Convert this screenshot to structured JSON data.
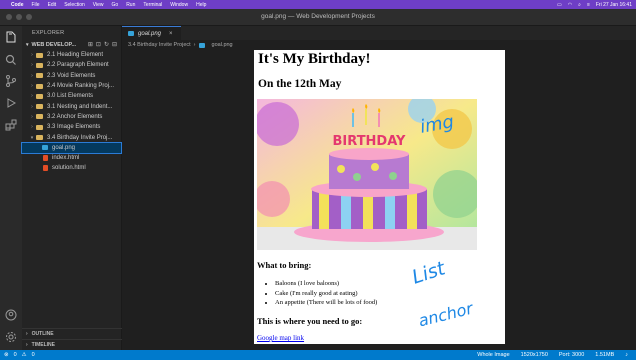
{
  "menubar": {
    "apple": "",
    "items": [
      "Code",
      "File",
      "Edit",
      "Selection",
      "View",
      "Go",
      "Run",
      "Terminal",
      "Window",
      "Help"
    ],
    "clock": "Fri 27 Jan 16:41"
  },
  "window": {
    "title": "goal.png — Web Development Projects"
  },
  "sidebar": {
    "header": "EXPLORER",
    "project": "WEB DEVELOP...",
    "items": [
      {
        "label": "2.1 Heading Element"
      },
      {
        "label": "2.2 Paragraph Element"
      },
      {
        "label": "2.3 Void Elements"
      },
      {
        "label": "2.4 Movie Ranking Proj..."
      },
      {
        "label": "3.0 List Elements"
      },
      {
        "label": "3.1 Nesting and Indent..."
      },
      {
        "label": "3.2 Anchor Elements"
      },
      {
        "label": "3.3 Image Elements"
      },
      {
        "label": "3.4 Birthday Invite Proj..."
      }
    ],
    "files": [
      {
        "label": "goal.png"
      },
      {
        "label": "index.html"
      },
      {
        "label": "solution.html"
      }
    ],
    "outline": "OUTLINE",
    "timeline": "TIMELINE"
  },
  "editor": {
    "tab": "goal.png",
    "breadcrumb": [
      "3.4 Birthday Invite Project",
      "goal.png"
    ]
  },
  "preview": {
    "h1": "It's My Birthday!",
    "h2": "On the 12th May",
    "bring_heading": "What to bring:",
    "bring_items": [
      "Baloons (I love baloons)",
      "Cake (I'm really good at eating)",
      "An appetite (There will be lots of food)"
    ],
    "where_heading": "This is where you need to go:",
    "map_link": "Google map link",
    "cake_text": "BIRTHDAY"
  },
  "annotations": {
    "img": "img",
    "list": "List",
    "anchor": "anchor"
  },
  "statusbar": {
    "errors": "0",
    "warnings": "0",
    "mode": "Whole Image",
    "dimensions": "1520x1750",
    "port": "Port: 3000",
    "size": "1.51MB"
  }
}
